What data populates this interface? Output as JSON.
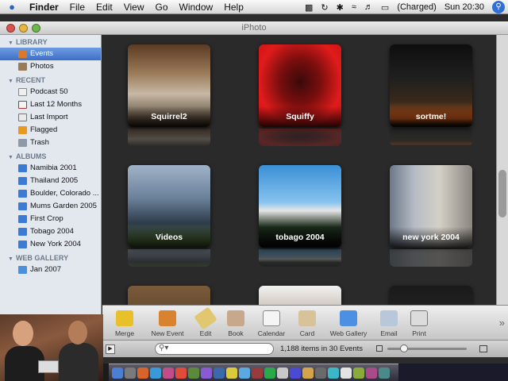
{
  "menubar": {
    "app_name": "Finder",
    "menus": [
      "File",
      "Edit",
      "View",
      "Go",
      "Window",
      "Help"
    ],
    "battery_status": "(Charged)",
    "clock": "Sun 20:30"
  },
  "window": {
    "title": "iPhoto"
  },
  "sidebar": {
    "library_header": "LIBRARY",
    "library": [
      {
        "label": "Events",
        "selected": true,
        "icon": "events-icon"
      },
      {
        "label": "Photos",
        "selected": false,
        "icon": "photos-icon"
      }
    ],
    "recent_header": "RECENT",
    "recent": [
      {
        "label": "Podcast 50",
        "icon": "podcast-icon"
      },
      {
        "label": "Last 12 Months",
        "icon": "calendar-icon"
      },
      {
        "label": "Last Import",
        "icon": "import-icon"
      },
      {
        "label": "Flagged",
        "icon": "flag-icon"
      },
      {
        "label": "Trash",
        "icon": "trash-icon"
      }
    ],
    "albums_header": "ALBUMS",
    "albums": [
      {
        "label": "Namibia 2001"
      },
      {
        "label": "Thailand 2005"
      },
      {
        "label": "Boulder, Colorado ..."
      },
      {
        "label": "Mums Garden 2005"
      },
      {
        "label": "First Crop"
      },
      {
        "label": "Tobago 2004"
      },
      {
        "label": "New York 2004"
      }
    ],
    "webgallery_header": "WEB GALLERY",
    "webgallery": [
      {
        "label": "Jan 2007",
        "icon": "web-gallery-icon"
      }
    ]
  },
  "events": [
    {
      "label": "Squirrel2"
    },
    {
      "label": "Squiffy"
    },
    {
      "label": "sortme!"
    },
    {
      "label": "Videos"
    },
    {
      "label": "tobago 2004"
    },
    {
      "label": "new york 2004"
    }
  ],
  "toolbar": {
    "merge": "Merge",
    "new_event": "New Event",
    "edit": "Edit",
    "book": "Book",
    "calendar": "Calendar",
    "card": "Card",
    "web_gallery": "Web Gallery",
    "email": "Email",
    "print": "Print"
  },
  "statusbar": {
    "search_placeholder": "",
    "count": "1,188 items in 30 Events"
  }
}
